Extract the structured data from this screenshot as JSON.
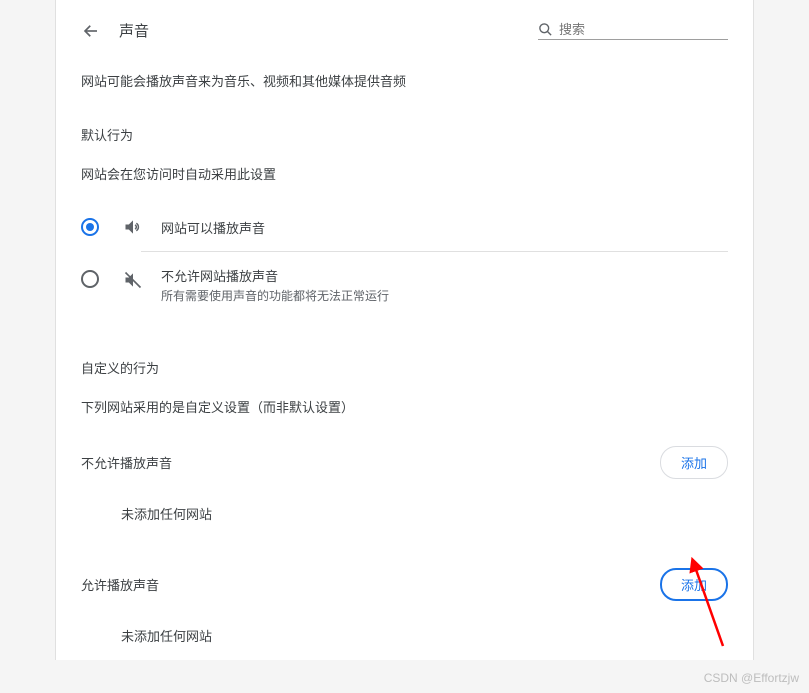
{
  "header": {
    "title": "声音",
    "search_placeholder": "搜索"
  },
  "description": "网站可能会播放声音来为音乐、视频和其他媒体提供音频",
  "default_behavior": {
    "title": "默认行为",
    "subtitle": "网站会在您访问时自动采用此设置",
    "options": [
      {
        "label": "网站可以播放声音",
        "selected": true
      },
      {
        "label": "不允许网站播放声音",
        "sub": "所有需要使用声音的功能都将无法正常运行",
        "selected": false
      }
    ]
  },
  "custom_behavior": {
    "title": "自定义的行为",
    "subtitle": "下列网站采用的是自定义设置（而非默认设置）",
    "sections": [
      {
        "label": "不允许播放声音",
        "button": "添加",
        "empty": "未添加任何网站",
        "focused": false
      },
      {
        "label": "允许播放声音",
        "button": "添加",
        "empty": "未添加任何网站",
        "focused": true
      }
    ]
  },
  "watermark": "CSDN @Effortzjw"
}
